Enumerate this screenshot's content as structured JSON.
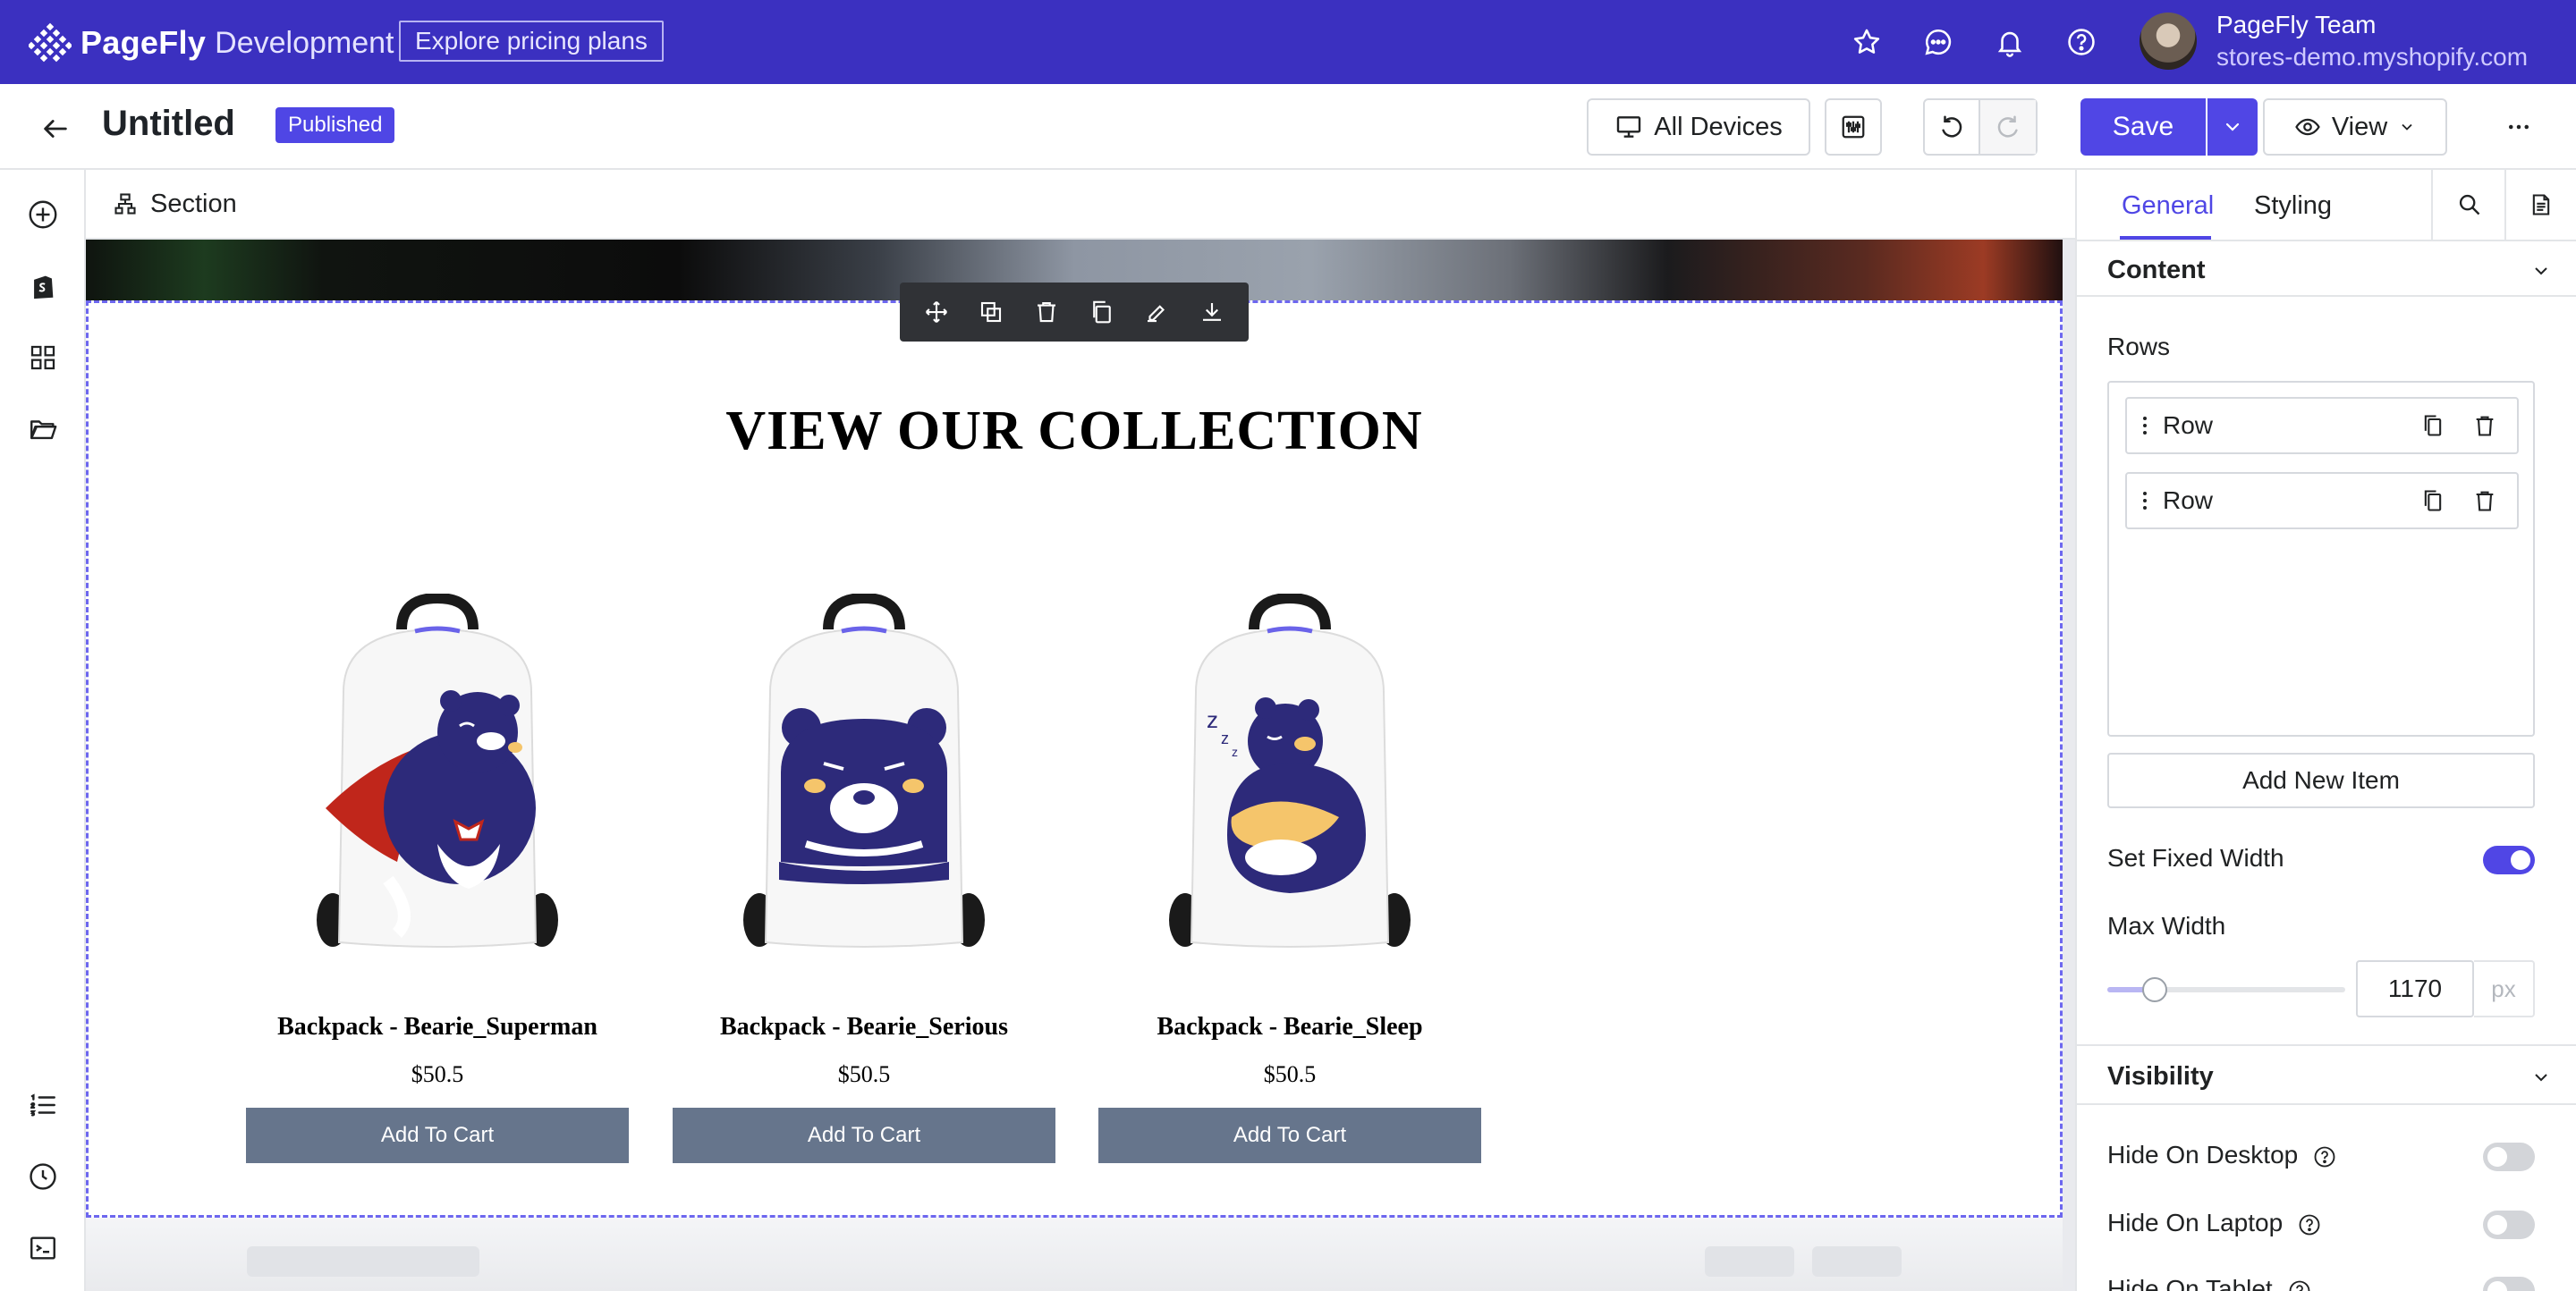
{
  "topbar": {
    "brand": "PageFly",
    "env": "Development",
    "pricing_label": "Explore pricing plans",
    "user_name": "PageFly Team",
    "user_store": "stores-demo.myshopify.com",
    "bg_color": "#3b30c0"
  },
  "editor": {
    "back_icon": "arrow-left-icon",
    "title": "Untitled",
    "status_badge": "Published",
    "devices_label": "All Devices",
    "save_label": "Save",
    "view_label": "View"
  },
  "canvas": {
    "breadcrumb": "Section",
    "collection_title": "VIEW OUR COLLECTION",
    "products": [
      {
        "name": "Backpack - Bearie_Superman",
        "price": "$50.5",
        "button": "Add To Cart"
      },
      {
        "name": "Backpack - Bearie_Serious",
        "price": "$50.5",
        "button": "Add To Cart"
      },
      {
        "name": "Backpack - Bearie_Sleep",
        "price": "$50.5",
        "button": "Add To Cart"
      }
    ],
    "button_color": "#66758c",
    "selection_color": "#6d67ef"
  },
  "panel": {
    "tabs": [
      "General",
      "Styling"
    ],
    "active_tab": "General",
    "content_heading": "Content",
    "rows_label": "Rows",
    "rows": [
      {
        "label": "Row"
      },
      {
        "label": "Row"
      }
    ],
    "add_item_label": "Add New Item",
    "set_fixed_width_label": "Set Fixed Width",
    "set_fixed_width": true,
    "max_width_label": "Max Width",
    "max_width_value": "1170",
    "max_width_unit": "px",
    "max_width_slider_fraction": 0.2,
    "visibility_heading": "Visibility",
    "hide_desktop_label": "Hide On Desktop",
    "hide_laptop_label": "Hide On Laptop",
    "hide_tablet_label": "Hide On Tablet",
    "hide_desktop": false,
    "hide_laptop": false,
    "hide_tablet": false,
    "accent_color": "#5046e5"
  }
}
